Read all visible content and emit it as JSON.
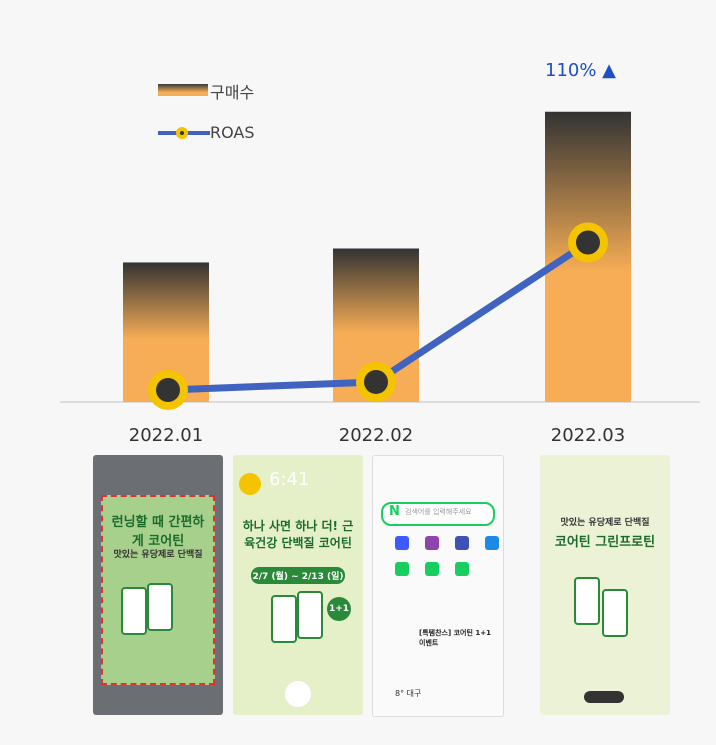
{
  "chart_data": {
    "type": "bar",
    "categories": [
      "2022.01",
      "2022.02",
      "2022.03"
    ],
    "series": [
      {
        "name": "구매수",
        "kind": "bar",
        "values": [
          1.0,
          1.1,
          2.08
        ]
      },
      {
        "name": "ROAS",
        "kind": "line",
        "values": [
          0.0,
          0.06,
          1.1
        ]
      }
    ],
    "ylim": [
      0,
      2.2
    ],
    "annotation": "110% ▲",
    "legend_position": "top-left",
    "grid": false,
    "colors": {
      "bar_top": "#333333",
      "bar_bottom": "#f6ad55",
      "line": "#4163c0",
      "marker_ring": "#f5c400",
      "marker_center": "#333333",
      "accent_text": "#1e4fc4"
    }
  },
  "thumbnails": [
    {
      "title": "런닝할 때 간편하게 코어틴",
      "subtitle": "맛있는 유당제로 단백질"
    },
    {
      "title": "하나 사면 하나 더! 근육건강 단백질 코어틴",
      "subtitle": "2/7 (월) ~ 2/13 (일)",
      "badge": "1+1",
      "time": "6:41"
    },
    {
      "search_placeholder": "검색어를 입력해주세요",
      "ad_title": "[특템찬스] 코어틴 1+1 이벤트",
      "weather": "8° 대구"
    },
    {
      "title": "코어틴 그린프로틴",
      "subtitle": "맛있는 유당제로 단백질"
    }
  ]
}
